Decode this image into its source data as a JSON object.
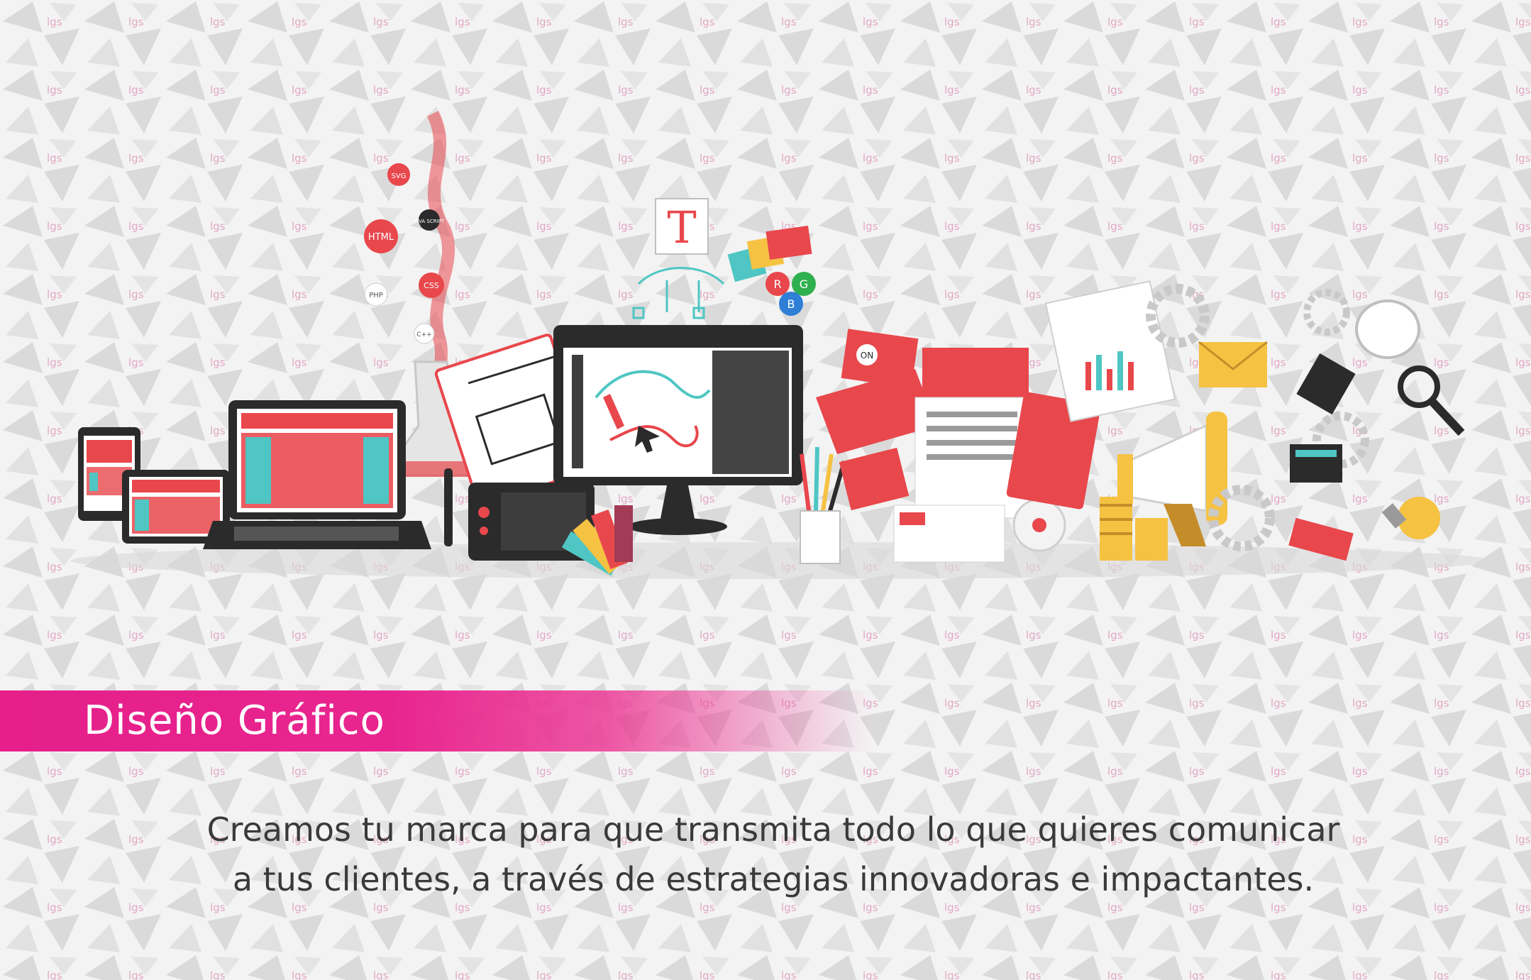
{
  "section_title": "Diseño Gráfico",
  "description_lines": [
    "Creamos tu marca para que transmita todo lo que quieres comunicar",
    "a tus clientes, a través de estrategias innovadoras e impactantes."
  ],
  "watermark_text": "lgs",
  "illustration": {
    "bubbles": [
      "SVG",
      "JAVA SCRIPT",
      "HTML",
      "CSS",
      "PHP",
      "C++"
    ],
    "type_tool_letter": "T",
    "color_channels": [
      "R",
      "G",
      "B"
    ],
    "logo_mark": "ON"
  },
  "colors": {
    "accent_pink": "#e61f8a",
    "illustration_red": "#e8474c",
    "illustration_teal": "#4fc6c3",
    "illustration_dark": "#2b2b2b",
    "coin_gold": "#f5c242",
    "background": "#f2f2f2"
  }
}
